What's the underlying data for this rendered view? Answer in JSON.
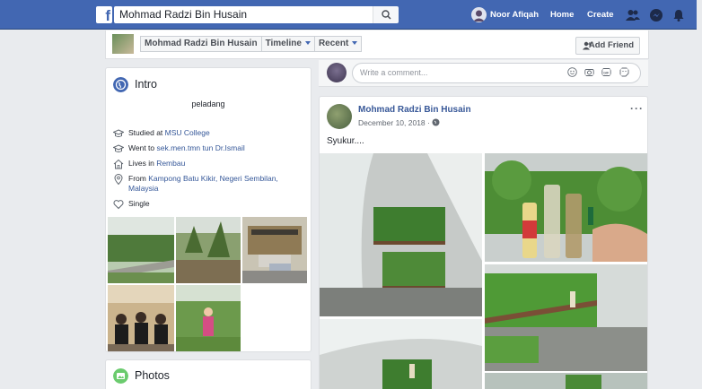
{
  "topbar": {
    "search_value": "Mohmad Radzi Bin Husain",
    "user_name": "Noor Afiqah",
    "home_label": "Home",
    "create_label": "Create",
    "logo_letter": "f"
  },
  "profile_header": {
    "name_tab": "Mohmad Radzi Bin Husain",
    "timeline_label": "Timeline",
    "recent_label": "Recent",
    "add_friend_label": "Add Friend"
  },
  "intro": {
    "title": "Intro",
    "bio": "peladang",
    "items": [
      {
        "icon": "graduation-cap-icon",
        "prefix": "Studied at ",
        "link": "MSU College",
        "suffix": ""
      },
      {
        "icon": "graduation-cap-icon",
        "prefix": "Went to ",
        "link": "sek.men.tmn tun Dr.Ismail",
        "suffix": ""
      },
      {
        "icon": "home-icon",
        "prefix": "Lives in ",
        "link": "Rembau",
        "suffix": ""
      },
      {
        "icon": "location-pin-icon",
        "prefix": "From ",
        "link": "Kampong Batu Kikir, Negeri Sembilan, Malaysia",
        "suffix": ""
      },
      {
        "icon": "heart-icon",
        "prefix": "Single",
        "link": "",
        "suffix": ""
      }
    ]
  },
  "photos": {
    "title": "Photos"
  },
  "composer": {
    "placeholder": "Write a comment..."
  },
  "post": {
    "author": "Mohmad Radzi Bin Husain",
    "date": "December 10, 2018 ·",
    "more": "···",
    "text": "Syukur...."
  },
  "colors": {
    "brand_blue": "#4267b2",
    "link_blue": "#365899",
    "page_bg": "#e9ebee"
  }
}
